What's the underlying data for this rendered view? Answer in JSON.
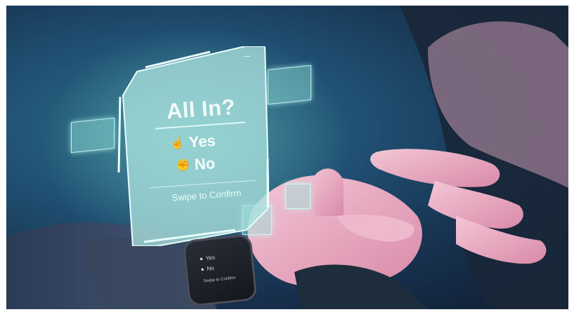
{
  "panel": {
    "title": "All In?",
    "options": [
      {
        "label": "Yes",
        "icon": "hand-point-icon"
      },
      {
        "label": "No",
        "icon": "hand-fist-icon"
      }
    ],
    "instruction": "Swipe to Confirm"
  },
  "colors": {
    "accent": "#7fe3d8",
    "background": "#1f4f72",
    "panel_fill": "#a9d8d6"
  }
}
